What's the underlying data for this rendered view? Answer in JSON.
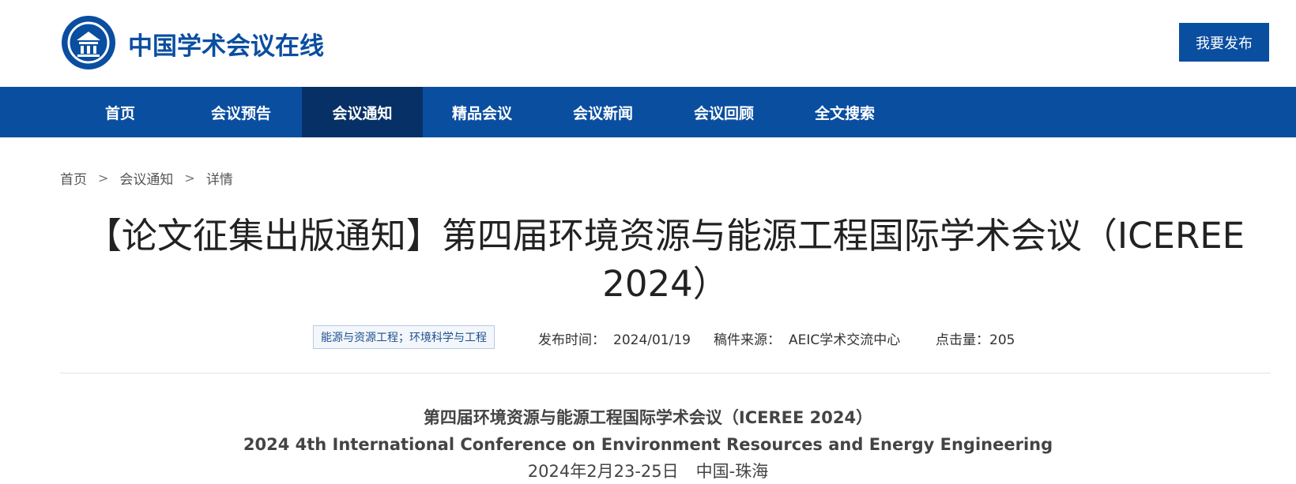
{
  "header": {
    "site_name": "中国学术会议在线",
    "publish_label": "我要发布"
  },
  "nav": {
    "items": [
      {
        "label": "首页"
      },
      {
        "label": "会议预告"
      },
      {
        "label": "会议通知"
      },
      {
        "label": "精品会议"
      },
      {
        "label": "会议新闻"
      },
      {
        "label": "会议回顾"
      },
      {
        "label": "全文搜索"
      }
    ],
    "active": "会议通知"
  },
  "breadcrumb": {
    "items": [
      "首页",
      "会议通知",
      "详情"
    ],
    "separator": ">"
  },
  "article": {
    "title": "【论文征集出版通知】第四届环境资源与能源工程国际学术会议（ICEREE 2024）",
    "tag": "能源与资源工程；环境科学与工程",
    "publish_time_label": "发布时间：",
    "publish_time": "2024/01/19",
    "source_label": "稿件来源：",
    "source": "AEIC学术交流中心",
    "clicks_label": "点击量：",
    "clicks": "205"
  },
  "content": {
    "title_cn": "第四届环境资源与能源工程国际学术会议（ICEREE 2024）",
    "title_en": "2024 4th International Conference on Environment Resources and Energy Engineering",
    "date": "2024年2月23-25日",
    "location": "中国-珠海"
  },
  "colors": {
    "brand_blue": "#0a4ea0",
    "nav_active": "#073166"
  }
}
